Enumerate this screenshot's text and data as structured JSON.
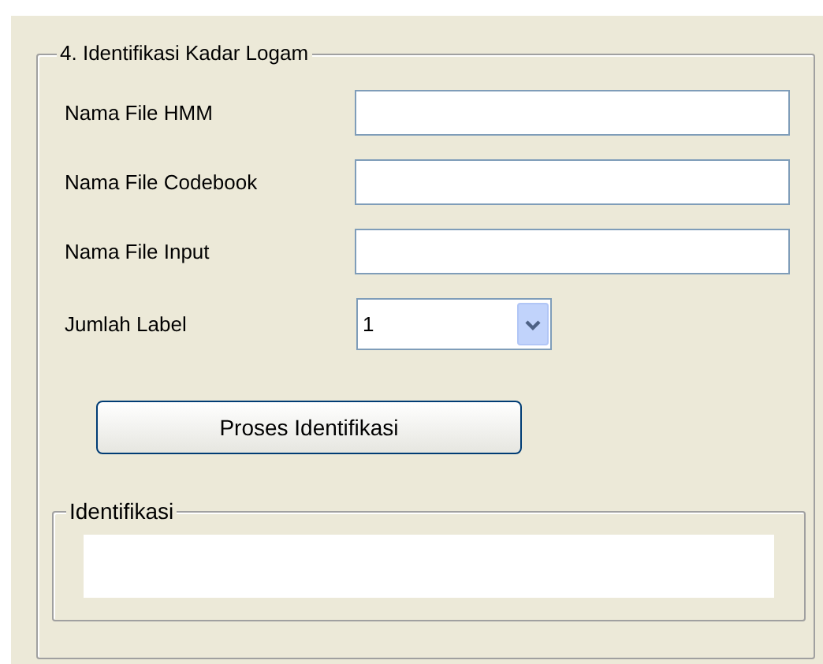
{
  "group": {
    "title": "4. Identifikasi Kadar Logam"
  },
  "fields": [
    {
      "label": "Nama File HMM"
    },
    {
      "label": "Nama File Codebook"
    },
    {
      "label": "Nama File Input"
    }
  ],
  "jumlah_label": {
    "label": "Jumlah Label",
    "value": "1"
  },
  "button": {
    "label": "Proses Identifikasi"
  },
  "result_group": {
    "title": "Identifikasi"
  }
}
